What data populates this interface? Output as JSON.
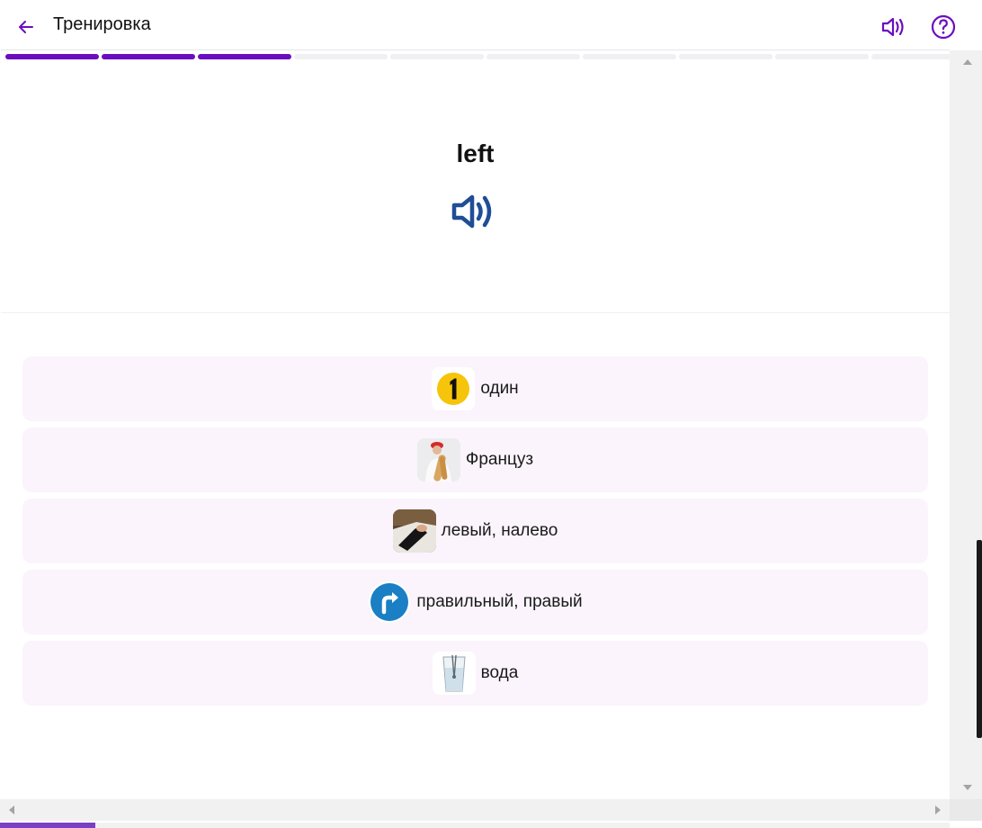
{
  "header": {
    "title": "Тренировка",
    "back_icon": "arrow-left-icon",
    "sound_icon": "speaker-icon",
    "help_icon": "question-circle-icon"
  },
  "progress": {
    "total_segments": 10,
    "completed_segments": 3
  },
  "word": {
    "text": "left",
    "sound_icon": "speaker-icon"
  },
  "options": [
    {
      "label": "один",
      "icon": "number-one-icon"
    },
    {
      "label": "Француз",
      "icon": "frenchman-image"
    },
    {
      "label": "левый, налево",
      "icon": "left-hand-image"
    },
    {
      "label": "правильный, правый",
      "icon": "turn-right-sign-icon"
    },
    {
      "label": "вода",
      "icon": "water-glass-image"
    }
  ],
  "bottom_progress": {
    "fraction": 0.1
  },
  "colors": {
    "accent": "#6b0dbf",
    "option_bg": "#fbf4fc",
    "word_sound": "#1f4e96",
    "sign_blue": "#1a7fc4",
    "number_yellow": "#f6c40a"
  }
}
